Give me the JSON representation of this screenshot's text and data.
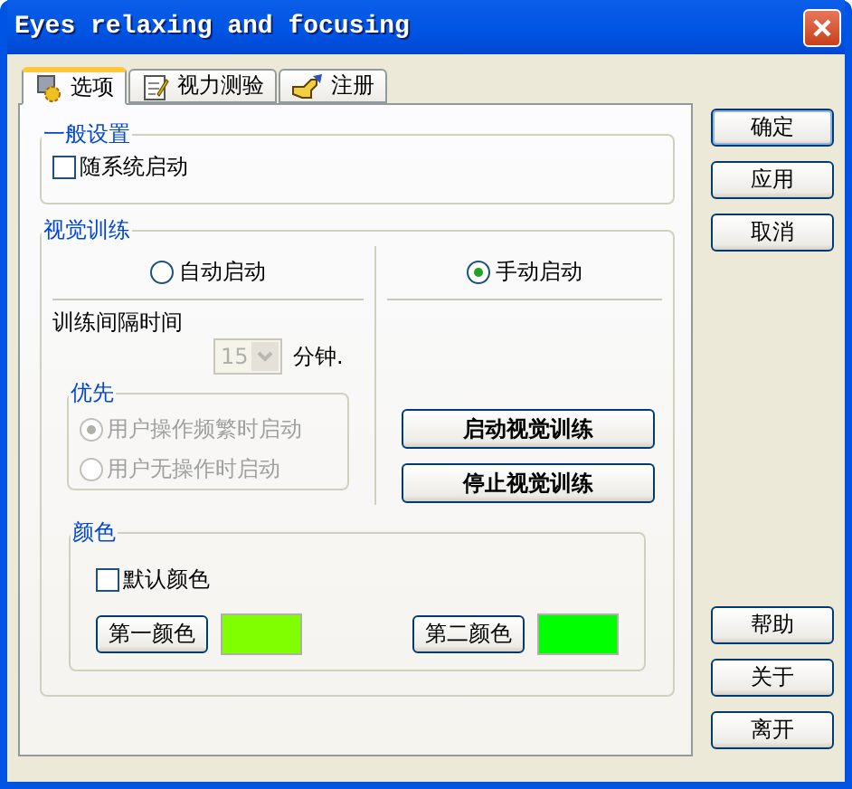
{
  "window": {
    "title": "Eyes relaxing and focusing"
  },
  "tabs": [
    {
      "label": "选项",
      "selected": true
    },
    {
      "label": "视力测验",
      "selected": false
    },
    {
      "label": "注册",
      "selected": false
    }
  ],
  "general": {
    "title": "一般设置",
    "autostart": {
      "label": "随系统启动",
      "checked": false
    }
  },
  "training": {
    "title": "视觉训练",
    "modes": [
      {
        "label": "自动启动",
        "selected": false
      },
      {
        "label": "手动启动",
        "selected": true
      }
    ],
    "interval_label": "训练间隔时间",
    "interval": {
      "value": "15",
      "disabled": true
    },
    "unit": "分钟.",
    "priority": {
      "title": "优先",
      "disabled": true,
      "options": [
        {
          "label": "用户操作频繁时启动",
          "selected": true
        },
        {
          "label": "用户无操作时启动",
          "selected": false
        }
      ]
    },
    "actions": [
      "启动视觉训练",
      "停止视觉训练"
    ],
    "color": {
      "title": "颜色",
      "default_color": {
        "label": "默认颜色",
        "checked": false
      },
      "colors": [
        {
          "label": "第一颜色",
          "color": "#80ff00"
        },
        {
          "label": "第二颜色",
          "color": "#00ff00"
        }
      ]
    }
  },
  "buttons_top": [
    "确定",
    "应用",
    "取消"
  ],
  "buttons_bottom": [
    "帮助",
    "关于",
    "离开"
  ]
}
